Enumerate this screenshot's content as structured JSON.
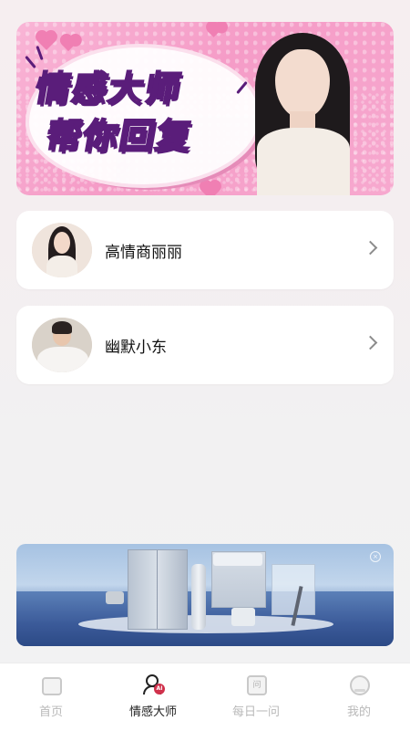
{
  "hero": {
    "title_line1": "情感大师",
    "title_line2": "帮你回复"
  },
  "personas": [
    {
      "name": "高情商丽丽",
      "avatar": "woman-avatar"
    },
    {
      "name": "幽默小东",
      "avatar": "man-avatar"
    }
  ],
  "ad": {
    "close_glyph": "×",
    "theme": "home-appliances"
  },
  "tabbar": {
    "tabs": [
      {
        "label": "首页",
        "icon": "home-icon",
        "active": false
      },
      {
        "label": "情感大师",
        "icon": "ai-person-icon",
        "active": true
      },
      {
        "label": "每日一问",
        "icon": "question-icon",
        "active": false
      },
      {
        "label": "我的",
        "icon": "profile-icon",
        "active": false
      }
    ],
    "ask_glyph": "问",
    "ai_badge": "AI"
  },
  "colors": {
    "hero_pink": "#f59cc7",
    "title_fill": "#ec4d9b",
    "title_stroke": "#5a1d7a",
    "tab_active": "#222222",
    "tab_inactive": "#b9b9b9",
    "badge_red": "#d0314b"
  }
}
